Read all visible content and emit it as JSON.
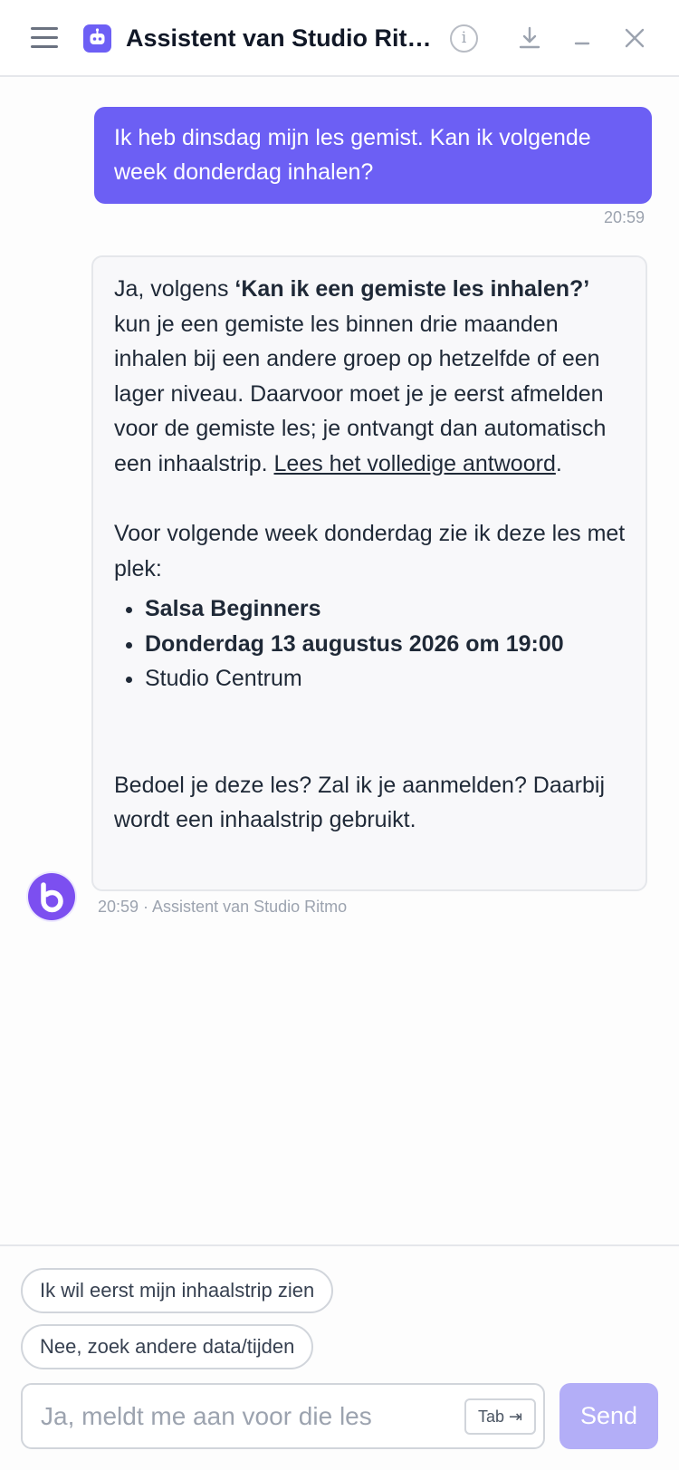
{
  "header": {
    "title": "Assistent van Studio Ritmo",
    "info_label": "i"
  },
  "conversation": {
    "user_message": {
      "text": "Ik heb dinsdag mijn les gemist. Kan ik volgende week donderdag inhalen?",
      "time": "20:59"
    },
    "bot_message": {
      "intro_prefix": "Ja, volgens ",
      "intro_bold": "‘Kan ik een gemiste les inhalen?’",
      "intro_body": " kun je een gemiste les binnen drie maanden inhalen bij een andere groep op hetzelfde of een lager niveau. Daarvoor moet je je eerst afmelden voor de gemiste les; je ontvangt dan automatisch een inhaalstrip. ",
      "link_text": "Lees het volledige antwoord",
      "link_suffix": ".",
      "availability_text": "Voor volgende week donderdag zie ik deze les met plek:",
      "class_items": [
        {
          "text": "Salsa Beginners",
          "bold": true
        },
        {
          "text": "Donderdag 13 augustus 2026 om 19:00",
          "bold": true
        },
        {
          "text": "Studio Centrum",
          "bold": false
        }
      ],
      "question": "Bedoel je deze les? Zal ik je aanmelden? Daarbij wordt een inhaalstrip gebruikt.",
      "meta": "20:59 · Assistent van Studio Ritmo"
    }
  },
  "suggestions": [
    "Ik wil eerst mijn inhaalstrip zien",
    "Nee, zoek andere data/tijden"
  ],
  "composer": {
    "placeholder": "Ja, meldt me aan voor die les",
    "tab_hint": "Tab ⇥",
    "send_label": "Send"
  },
  "colors": {
    "accent": "#6c5ff4",
    "send_disabled": "#b3aef7",
    "avatar": "#7c4ff0"
  },
  "icons": {
    "menu": "hamburger-icon",
    "logo": "robot-icon",
    "info": "info-icon",
    "download": "download-icon",
    "minimize": "minimize-icon",
    "close": "close-icon",
    "avatar": "bot-avatar-icon"
  }
}
